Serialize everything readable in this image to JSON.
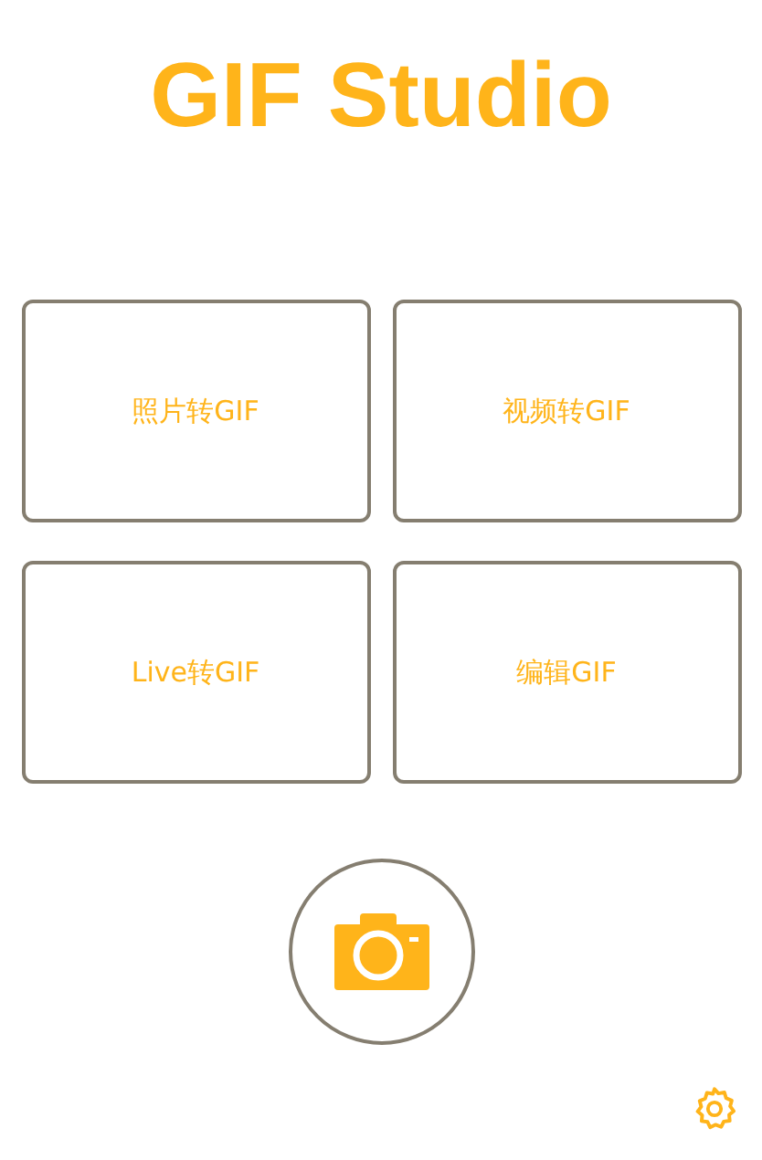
{
  "title": "GIF Studio",
  "actions": [
    {
      "label": "照片转GIF"
    },
    {
      "label": "视频转GIF"
    },
    {
      "label": "Live转GIF"
    },
    {
      "label": "编辑GIF"
    }
  ]
}
